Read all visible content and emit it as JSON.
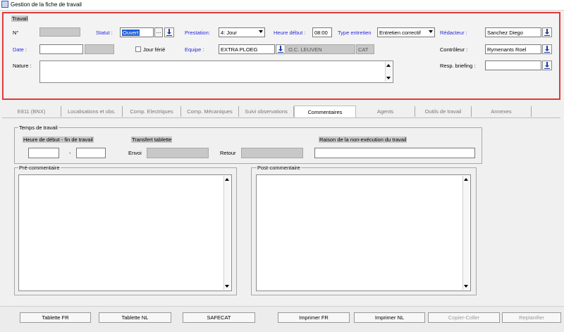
{
  "window": {
    "title": "Gestion de la fiche de travail"
  },
  "travail": {
    "section_label": "Travail",
    "numero_label": "N°",
    "statut_label": "Statut :",
    "statut_value": "Ouvert",
    "statut_more": "...",
    "prestation_label": "Prestation:",
    "prestation_value": "4: Jour",
    "heure_debut_label": "Heure début :",
    "heure_debut_value": "08:00",
    "type_entretien_label": "Type entretien",
    "type_entretien_value": "Entretien correctif",
    "redacteur_label": "Rédacteur :",
    "redacteur_value": "Sanchez Diego",
    "date_label": "Date :",
    "jour_ferie_label": "Jour férié",
    "equipe_label": "Equipe :",
    "equipe_value": "EXTRA PLOEG",
    "equipe_location": "O.C. LEUVEN",
    "equipe_code": "CAT",
    "controleur_label": "Contrôleur :",
    "controleur_value": "Rymenants Roel",
    "nature_label": "Nature :",
    "resp_briefing_label": "Resp. briefing :"
  },
  "tabs": [
    {
      "label": "E811 (BNX)"
    },
    {
      "label": "Localisations et obs."
    },
    {
      "label": "Comp. Electriques"
    },
    {
      "label": "Comp. Mécaniques"
    },
    {
      "label": "Suivi observations"
    },
    {
      "label": "Commentaires"
    },
    {
      "label": "Agents"
    },
    {
      "label": "Outils de travail"
    },
    {
      "label": "Annexes"
    }
  ],
  "active_tab": "Commentaires",
  "temps": {
    "group_label": "Temps de travail",
    "heure_label": "Heure de début - fin de travail",
    "dash": "-",
    "transfert_label": "Transfert tablette",
    "envoi_label": "Envoi",
    "retour_label": "Retour",
    "raison_label": "Raison de la non-exécution du travail"
  },
  "pre_commentaire_label": "Pré-commentaire",
  "post_commentaire_label": "Post-commentaire",
  "buttons": {
    "tablette_fr": "Tablette FR",
    "tablette_nl": "Tablette NL",
    "safecat": "SAFECAT",
    "imprimer_fr": "Imprimer FR",
    "imprimer_nl": "Imprimer NL",
    "copier_coller": "Copier-Coller",
    "replanifier": "Replanifier"
  },
  "colors": {
    "highlight_border": "#e03a3a",
    "blue_label": "#2a2ad8",
    "selection": "#1f5fd6"
  },
  "icons": {
    "download": "download-arrow-icon",
    "dropdown": "chevron-down-icon",
    "app": "app-window-icon"
  }
}
